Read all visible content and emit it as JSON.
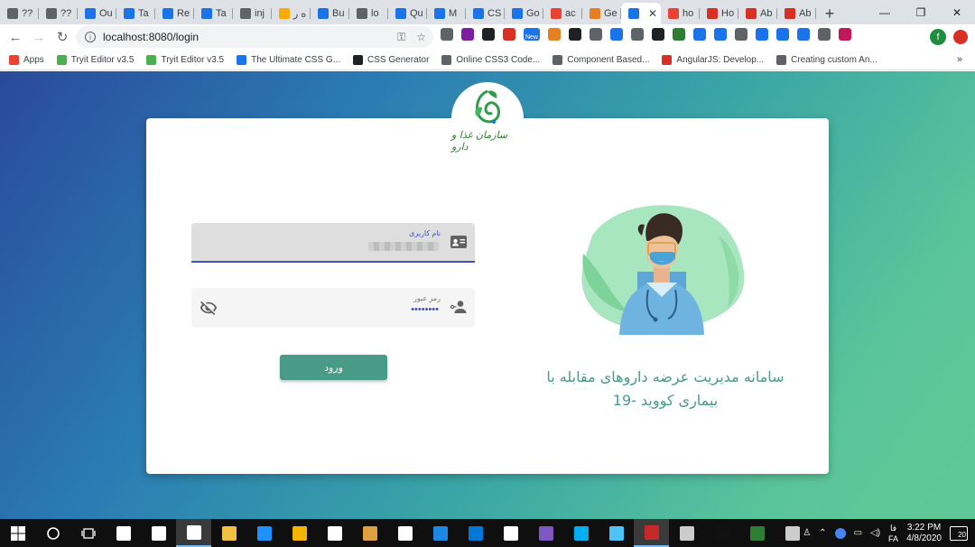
{
  "browser": {
    "tabs": [
      {
        "label": "??",
        "color": "#5f6368"
      },
      {
        "label": "??",
        "color": "#5f6368"
      },
      {
        "label": "Ou",
        "color": "#1a73e8"
      },
      {
        "label": "Ta",
        "color": "#1a73e8"
      },
      {
        "label": "Re",
        "color": "#1a73e8"
      },
      {
        "label": "Ta",
        "color": "#1a73e8"
      },
      {
        "label": "inj",
        "color": "#5f6368"
      },
      {
        "label": "ه ر",
        "color": "#f9ab00"
      },
      {
        "label": "Bu",
        "color": "#1a73e8"
      },
      {
        "label": "lo",
        "color": "#5f6368"
      },
      {
        "label": "Qu",
        "color": "#1a73e8"
      },
      {
        "label": "M",
        "color": "#1a73e8"
      },
      {
        "label": "CS",
        "color": "#1a73e8"
      },
      {
        "label": "Go",
        "color": "#1a73e8"
      },
      {
        "label": "ac",
        "color": "#ea4335"
      },
      {
        "label": "Ge",
        "color": "#e67e22"
      },
      {
        "label": "",
        "color": "#1a73e8",
        "active": true
      },
      {
        "label": "ho",
        "color": "#ea4335"
      },
      {
        "label": "Ho",
        "color": "#d93025"
      },
      {
        "label": "Ab",
        "color": "#d93025"
      },
      {
        "label": "Ab",
        "color": "#d93025"
      }
    ],
    "new_tab": "+",
    "close_tab": "✕",
    "window": {
      "minimize": "—",
      "maximize": "❐",
      "close": "✕"
    },
    "nav": {
      "back": "←",
      "forward": "→",
      "reload": "↻"
    },
    "url": "localhost:8080/login",
    "omnibox_icons": {
      "key": "⚿",
      "star": "☆"
    },
    "extensions": [
      "#5f6368",
      "#7b1fa2",
      "#202124",
      "#d93025",
      "#5f6368",
      "#e67e22",
      "#202124",
      "#5f6368",
      "#1a73e8",
      "#5f6368",
      "#202124",
      "#2e7d32",
      "#1a73e8",
      "#1a73e8",
      "#5f6368",
      "#1a73e8",
      "#1a73e8",
      "#1a73e8",
      "#5f6368",
      "#c2185b"
    ],
    "new_badge": "New",
    "profile_initial": "f",
    "bookmarks": [
      {
        "label": "Apps",
        "color": "#ea4335"
      },
      {
        "label": "Tryit Editor v3.5",
        "color": "#4caf50"
      },
      {
        "label": "Tryit Editor v3.5",
        "color": "#4caf50"
      },
      {
        "label": "The Ultimate CSS G...",
        "color": "#1a73e8"
      },
      {
        "label": "CSS Generator",
        "color": "#202124"
      },
      {
        "label": "Online CSS3 Code...",
        "color": "#5f6368"
      },
      {
        "label": "Component Based...",
        "color": "#5f6368"
      },
      {
        "label": "AngularJS: Develop...",
        "color": "#d93025"
      },
      {
        "label": "Creating custom An...",
        "color": "#5f6368"
      }
    ],
    "bookmarks_more": "»"
  },
  "login": {
    "logo_caption": "سازمان غذا و دارو",
    "username_label": "نام کاربری",
    "password_label": "رمز عبور",
    "password_mask": "••••••••",
    "submit_label": "ورود",
    "tagline": "سامانه مدیریت عرضه داروهای مقابله با بیماری کووید -19"
  },
  "taskbar": {
    "apps": [
      "#ffffff",
      "#ffffff",
      "#ffffff",
      "#f0c040",
      "#1e90ff",
      "#f4b400",
      "#ffffff",
      "#e0a040",
      "#ffffff",
      "#1e88e5",
      "#0078d4",
      "#ffffff",
      "#7e57c2",
      "#00aff0",
      "#4fc3f7",
      "#c62828",
      "#cccccc",
      "#111111",
      "#2e7d32",
      "#cccccc"
    ],
    "lang": {
      "top": "فا",
      "bottom": "FA"
    },
    "time": "3:22 PM",
    "date": "4/8/2020",
    "notifications": "20"
  }
}
